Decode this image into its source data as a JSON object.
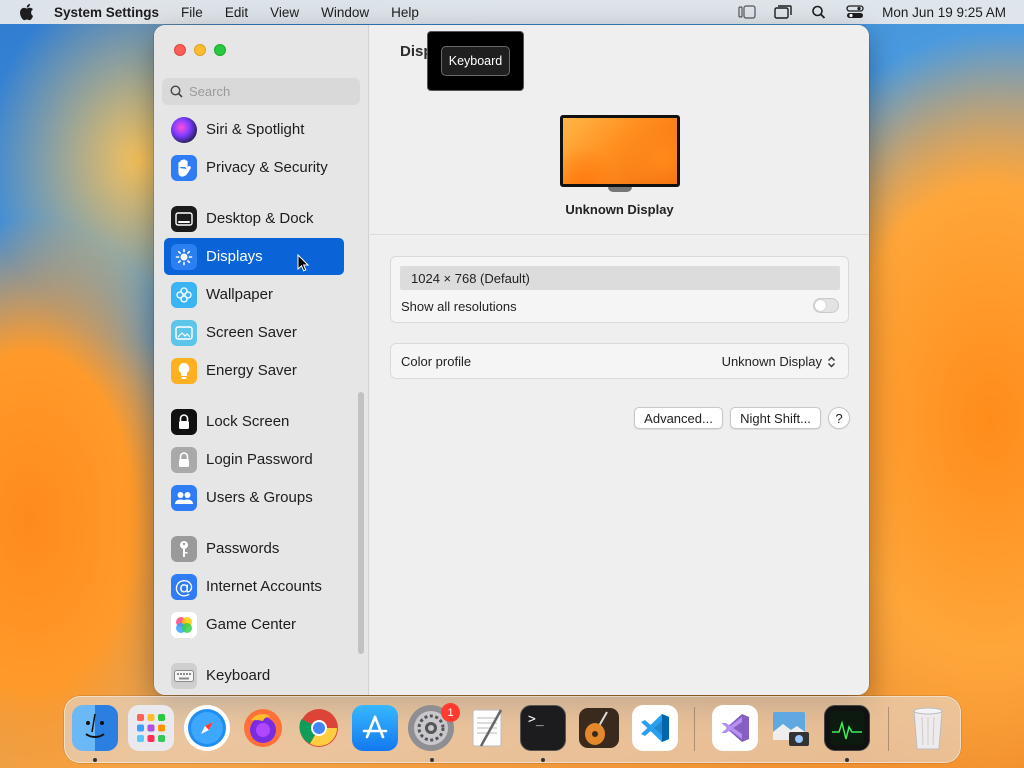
{
  "menubar": {
    "app_name": "System Settings",
    "menus": [
      "File",
      "Edit",
      "View",
      "Window",
      "Help"
    ],
    "datetime": "Mon Jun 19  9:25 AM"
  },
  "sidebar": {
    "search_placeholder": "Search",
    "items": [
      {
        "label": "Siri & Spotlight",
        "icon": "siri-icon"
      },
      {
        "label": "Privacy & Security",
        "icon": "hand-icon"
      },
      {
        "label": "Desktop & Dock",
        "icon": "desktop-dock-icon"
      },
      {
        "label": "Displays",
        "icon": "sun-icon",
        "selected": true
      },
      {
        "label": "Wallpaper",
        "icon": "flower-icon"
      },
      {
        "label": "Screen Saver",
        "icon": "screensaver-icon"
      },
      {
        "label": "Energy Saver",
        "icon": "bulb-icon"
      },
      {
        "label": "Lock Screen",
        "icon": "lock-icon"
      },
      {
        "label": "Login Password",
        "icon": "lock-icon"
      },
      {
        "label": "Users & Groups",
        "icon": "users-icon"
      },
      {
        "label": "Passwords",
        "icon": "key-icon"
      },
      {
        "label": "Internet Accounts",
        "icon": "at-icon"
      },
      {
        "label": "Game Center",
        "icon": "gamecenter-icon"
      },
      {
        "label": "Keyboard",
        "icon": "keyboard-icon"
      }
    ]
  },
  "content": {
    "title": "Disp",
    "tooltip": "Keyboard",
    "display_name": "Unknown Display",
    "resolution": "1024 × 768 (Default)",
    "show_all_resolutions_label": "Show all resolutions",
    "show_all_resolutions_on": false,
    "color_profile_label": "Color profile",
    "color_profile_value": "Unknown Display",
    "advanced_label": "Advanced...",
    "night_shift_label": "Night Shift...",
    "help_label": "?"
  },
  "dock": {
    "apps": [
      "Finder",
      "Launchpad",
      "Safari",
      "Firefox",
      "Chrome",
      "App Store",
      "System Settings",
      "TextEdit",
      "Terminal",
      "GarageBand",
      "VS Code",
      "Visual Studio",
      "Preview",
      "Activity Monitor",
      "Trash"
    ],
    "settings_badge": "1"
  },
  "colors": {
    "accent": "#0a64d8",
    "close": "#ff5f57",
    "minimize": "#febc2e",
    "zoom": "#28c840"
  }
}
